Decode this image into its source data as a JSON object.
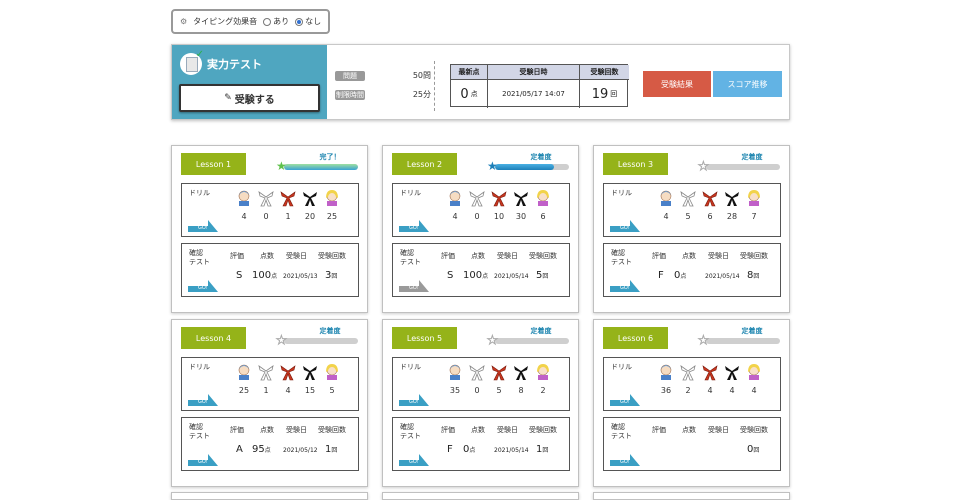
{
  "sound": {
    "label": "タイピング効果音",
    "opt_on": "あり",
    "opt_off": "なし",
    "selected": "なし"
  },
  "test": {
    "title": "実力テスト",
    "take_button": "受験する",
    "questions_label": "問題",
    "questions_value": "50問",
    "time_label": "制限時間",
    "time_value": "25分",
    "headers": {
      "latest": "最新点",
      "datetime": "受験日時",
      "count": "受験回数"
    },
    "latest_score": "0",
    "score_unit": "点",
    "datetime": "2021/05/17 14:07",
    "count": "19",
    "count_unit": "回",
    "results_button": "受験結果",
    "score_trend_button": "スコア推移"
  },
  "labels": {
    "drill": "ドリル",
    "confirm_line1": "確認",
    "confirm_line2": "テスト",
    "go": "GO!",
    "col_grade": "評価",
    "col_score": "点数",
    "col_date": "受験日",
    "col_count": "受験回数",
    "score_unit": "点",
    "count_unit": "回"
  },
  "colors": {
    "lesson_tag": "#95b319",
    "progress": "#1d7fb8",
    "results_btn": "#d65a45",
    "trend_btn": "#62b3e4",
    "panel": "#4fa6c0"
  },
  "lessons": [
    {
      "name": "Lesson 1",
      "progress_label": "完了！",
      "progress": 1.0,
      "drill": [
        "4",
        "0",
        "1",
        "20",
        "25"
      ],
      "grade": "S",
      "score": "100",
      "date": "2021/05/13",
      "count": "3"
    },
    {
      "name": "Lesson 2",
      "progress_label": "定着度",
      "progress": 0.8,
      "drill": [
        "4",
        "0",
        "10",
        "30",
        "6"
      ],
      "grade": "S",
      "score": "100",
      "date": "2021/05/14",
      "count": "5"
    },
    {
      "name": "Lesson 3",
      "progress_label": "定着度",
      "progress": 0.0,
      "drill": [
        "4",
        "5",
        "6",
        "28",
        "7"
      ],
      "grade": "F",
      "score": "0",
      "date": "2021/05/14",
      "count": "8"
    },
    {
      "name": "Lesson 4",
      "progress_label": "定着度",
      "progress": 0.0,
      "drill": [
        "25",
        "1",
        "4",
        "15",
        "5"
      ],
      "grade": "A",
      "score": "95",
      "date": "2021/05/12",
      "count": "1"
    },
    {
      "name": "Lesson 5",
      "progress_label": "定着度",
      "progress": 0.0,
      "drill": [
        "35",
        "0",
        "5",
        "8",
        "2"
      ],
      "grade": "F",
      "score": "0",
      "date": "2021/05/14",
      "count": "1"
    },
    {
      "name": "Lesson 6",
      "progress_label": "定着度",
      "progress": 0.0,
      "drill": [
        "36",
        "2",
        "4",
        "4",
        "4"
      ],
      "grade": "",
      "score": "",
      "date": "",
      "count": "0"
    }
  ],
  "drill_icon_names": [
    "student-face-icon",
    "white-belt-icon",
    "red-belt-icon",
    "black-belt-icon",
    "teacher-face-icon"
  ]
}
